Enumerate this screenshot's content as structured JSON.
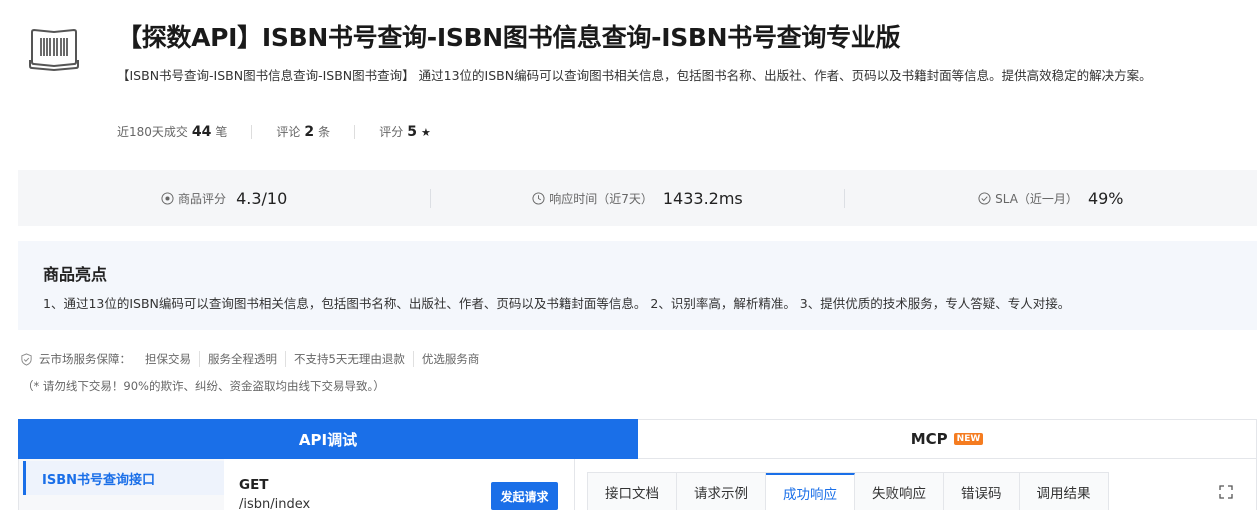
{
  "product": {
    "title": "【探数API】ISBN书号查询-ISBN图书信息查询-ISBN书号查询专业版",
    "description": "【ISBN书号查询-ISBN图书信息查询-ISBN图书查询】 通过13位的ISBN编码可以查询图书相关信息，包括图书名称、出版社、作者、页码以及书籍封面等信息。提供高效稳定的解决方案。",
    "icon": "barcode-book-icon"
  },
  "stats": {
    "deals_label": "近180天成交",
    "deals_value": "44",
    "deals_unit": "笔",
    "reviews_label": "评论",
    "reviews_value": "2",
    "reviews_unit": "条",
    "rating_label": "评分",
    "rating_value": "5",
    "rating_star": "★"
  },
  "metrics": {
    "score_label": "商品评分",
    "score_value": "4.3/10",
    "response_label": "响应时间（近7天）",
    "response_value": "1433.2ms",
    "sla_label": "SLA（近一月）",
    "sla_value": "49%"
  },
  "highlights": {
    "heading": "商品亮点",
    "text": "1、通过13位的ISBN编码可以查询图书相关信息，包括图书名称、出版社、作者、页码以及书籍封面等信息。 2、识别率高，解析精准。 3、提供优质的技术服务，专人答疑、专人对接。"
  },
  "guarantee": {
    "label": "云市场服务保障：",
    "items": [
      "担保交易",
      "服务全程透明",
      "不支持5天无理由退款",
      "优选服务商"
    ],
    "warning": "（* 请勿线下交易！90%的欺诈、纠纷、资金盗取均由线下交易导致。）"
  },
  "main_tabs": {
    "api": "API调试",
    "mcp": "MCP",
    "mcp_badge": "NEW"
  },
  "api": {
    "side_item": "ISBN书号查询接口",
    "method": "GET",
    "path": "/isbn/index",
    "send_button": "发起请求"
  },
  "doc_tabs": [
    "接口文档",
    "请求示例",
    "成功响应",
    "失败响应",
    "错误码",
    "调用结果"
  ],
  "colors": {
    "primary": "#1a6fe8",
    "badge": "#f57c20"
  }
}
